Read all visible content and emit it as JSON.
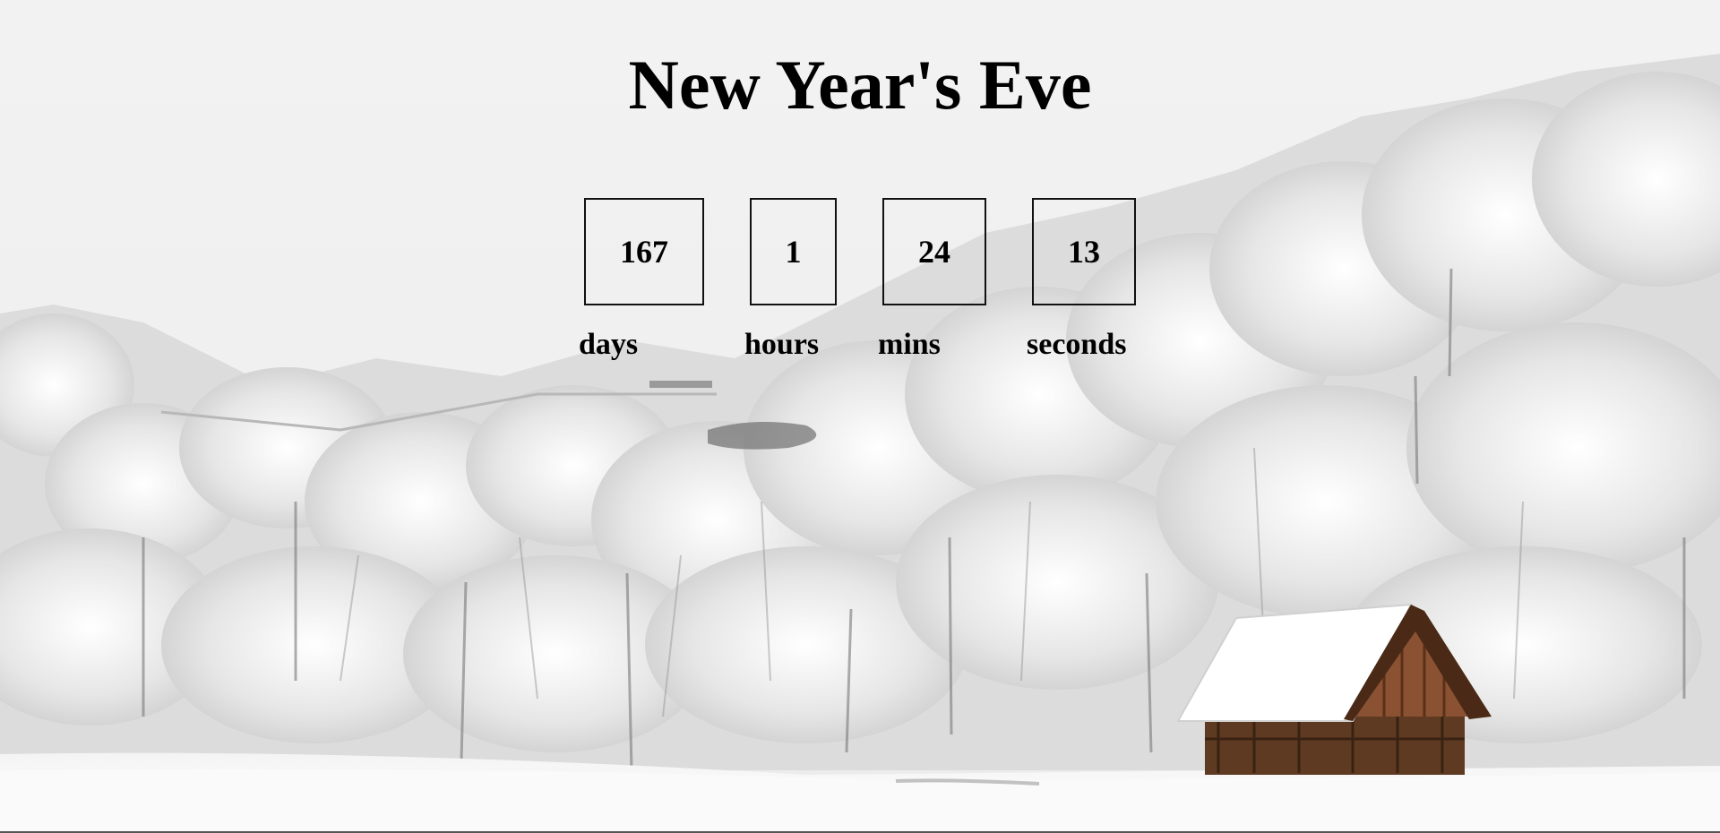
{
  "title": "New Year's Eve",
  "countdown": [
    {
      "value": "167",
      "unit": "days"
    },
    {
      "value": "1",
      "unit": "hours"
    },
    {
      "value": "24",
      "unit": "mins"
    },
    {
      "value": "13",
      "unit": "seconds"
    }
  ],
  "colors": {
    "text": "#000000",
    "sky": "#f0f0f0",
    "snow": "#ffffff",
    "cabin_wood": "#6b3a1f"
  }
}
